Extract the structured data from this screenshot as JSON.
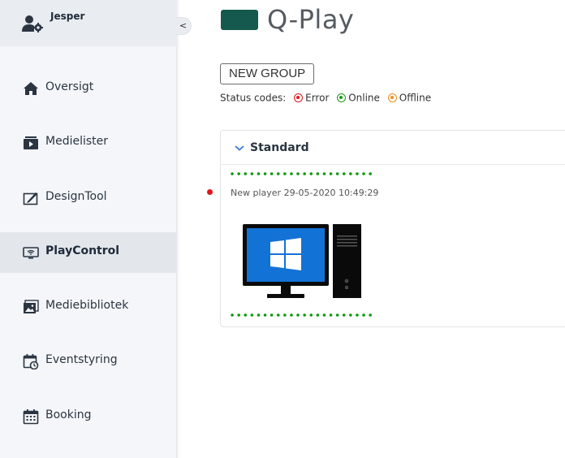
{
  "user": {
    "name": "Jesper",
    "icon": "user-gear-icon"
  },
  "sidebar": {
    "collapse_label": "<",
    "items": [
      {
        "label": "Oversigt",
        "icon": "home-icon",
        "active": false
      },
      {
        "label": "Medielister",
        "icon": "playlist-icon",
        "active": false
      },
      {
        "label": "DesignTool",
        "icon": "design-tool-icon",
        "active": false
      },
      {
        "label": "PlayControl",
        "icon": "play-control-icon",
        "active": true
      },
      {
        "label": "Mediebibliotek",
        "icon": "media-library-icon",
        "active": false
      },
      {
        "label": "Eventstyring",
        "icon": "event-calendar-icon",
        "active": false
      },
      {
        "label": "Booking",
        "icon": "booking-calendar-icon",
        "active": false
      }
    ]
  },
  "header": {
    "title": "Q-Play",
    "logo_color": "#15584e"
  },
  "toolbar": {
    "new_group_label": "NEW GROUP"
  },
  "status_codes": {
    "label": "Status codes:",
    "items": [
      {
        "label": "Error",
        "color": "#e0151b"
      },
      {
        "label": "Online",
        "color": "#1e9a1e"
      },
      {
        "label": "Offline",
        "color": "#f08c1a"
      }
    ]
  },
  "group": {
    "title": "Standard",
    "players": [
      {
        "name": "New player 29-05-2020 10:49:29",
        "status": "Error",
        "dot_color": "#e0151b",
        "border_color": "#0a9a0a"
      }
    ]
  }
}
